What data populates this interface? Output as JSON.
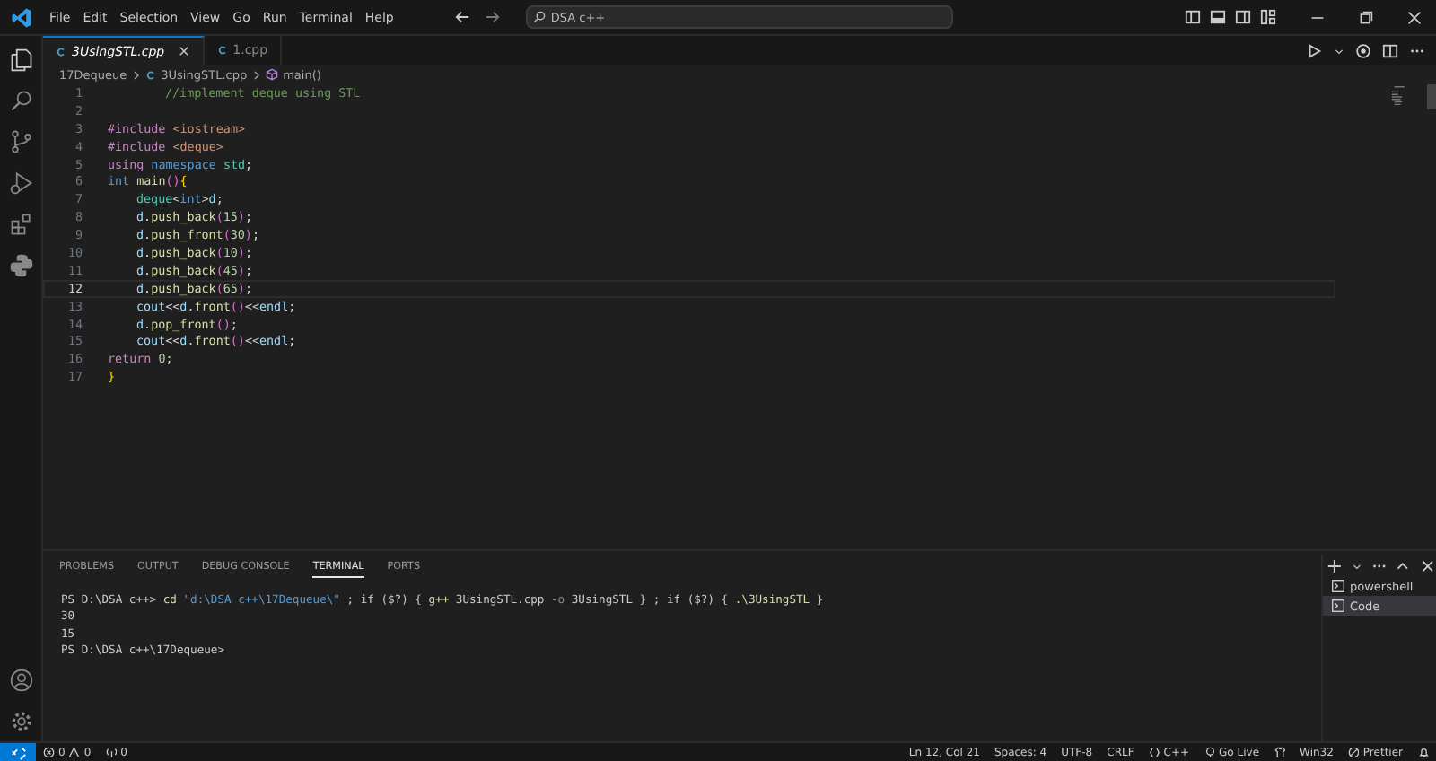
{
  "menu": [
    "File",
    "Edit",
    "Selection",
    "View",
    "Go",
    "Run",
    "Terminal",
    "Help"
  ],
  "search": {
    "value": "DSA c++"
  },
  "tabs": [
    {
      "label": "3UsingSTL.cpp",
      "selected": true
    },
    {
      "label": "1.cpp",
      "selected": false
    }
  ],
  "breadcrumbs": [
    "17Dequeue",
    "3UsingSTL.cpp",
    "main()"
  ],
  "code": {
    "lines": [
      {
        "number": "1",
        "kind": "comment",
        "current": false,
        "tokens": [
          {
            "kind": "comment",
            "text": "//implement deque using STL"
          }
        ]
      },
      {
        "number": "2",
        "current": false
      },
      {
        "number": "3",
        "current": false,
        "tokens": [
          {
            "kind": "directive",
            "text": "#include "
          },
          {
            "kind": "string",
            "text": "<iostream>"
          }
        ]
      },
      {
        "number": "4",
        "current": false,
        "tokens": [
          {
            "kind": "directive",
            "text": "#include "
          },
          {
            "kind": "string",
            "text": "<deque>"
          }
        ]
      },
      {
        "number": "5",
        "current": false,
        "tokens": [
          {
            "kind": "directive",
            "text": "using "
          },
          {
            "kind": "keyword",
            "text": "namespace "
          },
          {
            "kind": "type",
            "text": "std"
          },
          {
            "kind": "plain",
            "text": ";"
          }
        ]
      },
      {
        "number": "6",
        "current": false,
        "tokens": [
          {
            "kind": "keyword",
            "text": "int "
          },
          {
            "kind": "func",
            "text": "main"
          },
          {
            "kind": "bracket",
            "text": "()"
          },
          {
            "kind": "bracket2",
            "text": "{"
          }
        ],
        "children": [
          {
            "number": "7",
            "current": false,
            "tokens": [
              {
                "kind": "type",
                "text": "deque"
              },
              {
                "kind": "plain",
                "text": "<"
              },
              {
                "kind": "keyword",
                "text": "int"
              },
              {
                "kind": "plain",
                "text": ">"
              },
              {
                "kind": "var",
                "text": "d"
              },
              {
                "kind": "plain",
                "text": ";"
              }
            ]
          },
          {
            "number": "8",
            "current": false,
            "tokens": [
              {
                "kind": "var",
                "text": "d"
              },
              {
                "kind": "plain",
                "text": "."
              },
              {
                "kind": "func",
                "text": "push_back"
              },
              {
                "kind": "bracket",
                "text": "("
              },
              {
                "kind": "number",
                "text": "15"
              },
              {
                "kind": "bracket",
                "text": ")"
              },
              {
                "kind": "plain",
                "text": ";"
              }
            ]
          },
          {
            "number": "9",
            "current": false,
            "tokens": [
              {
                "kind": "var",
                "text": "d"
              },
              {
                "kind": "plain",
                "text": "."
              },
              {
                "kind": "func",
                "text": "push_front"
              },
              {
                "kind": "bracket",
                "text": "("
              },
              {
                "kind": "number",
                "text": "30"
              },
              {
                "kind": "bracket",
                "text": ")"
              },
              {
                "kind": "plain",
                "text": ";"
              }
            ]
          },
          {
            "number": "10",
            "current": false,
            "tokens": [
              {
                "kind": "var",
                "text": "d"
              },
              {
                "kind": "plain",
                "text": "."
              },
              {
                "kind": "func",
                "text": "push_back"
              },
              {
                "kind": "bracket",
                "text": "("
              },
              {
                "kind": "number",
                "text": "10"
              },
              {
                "kind": "bracket",
                "text": ")"
              },
              {
                "kind": "plain",
                "text": ";"
              }
            ]
          },
          {
            "number": "11",
            "current": false,
            "tokens": [
              {
                "kind": "var",
                "text": "d"
              },
              {
                "kind": "plain",
                "text": "."
              },
              {
                "kind": "func",
                "text": "push_back"
              },
              {
                "kind": "bracket",
                "text": "("
              },
              {
                "kind": "number",
                "text": "45"
              },
              {
                "kind": "bracket",
                "text": ")"
              },
              {
                "kind": "plain",
                "text": ";"
              }
            ]
          },
          {
            "number": "12",
            "current": true,
            "tokens": [
              {
                "kind": "var",
                "text": "d"
              },
              {
                "kind": "plain",
                "text": "."
              },
              {
                "kind": "func",
                "text": "push_back"
              },
              {
                "kind": "bracket",
                "text": "("
              },
              {
                "kind": "number",
                "text": "65"
              },
              {
                "kind": "bracket",
                "text": ")"
              },
              {
                "kind": "plain",
                "text": ";"
              }
            ]
          },
          {
            "number": "13",
            "current": false,
            "tokens": [
              {
                "kind": "var",
                "text": "cout"
              },
              {
                "kind": "plain",
                "text": "<<"
              },
              {
                "kind": "var",
                "text": "d"
              },
              {
                "kind": "plain",
                "text": "."
              },
              {
                "kind": "func",
                "text": "front"
              },
              {
                "kind": "bracket",
                "text": "()"
              },
              {
                "kind": "plain",
                "text": "<<"
              },
              {
                "kind": "var",
                "text": "endl"
              },
              {
                "kind": "plain",
                "text": ";"
              }
            ]
          },
          {
            "number": "14",
            "current": false,
            "tokens": [
              {
                "kind": "var",
                "text": "d"
              },
              {
                "kind": "plain",
                "text": "."
              },
              {
                "kind": "func",
                "text": "pop_front"
              },
              {
                "kind": "bracket",
                "text": "()"
              },
              {
                "kind": "plain",
                "text": ";"
              }
            ]
          },
          {
            "number": "15",
            "current": false,
            "tokens": [
              {
                "kind": "var",
                "text": "cout"
              },
              {
                "kind": "plain",
                "text": "<<"
              },
              {
                "kind": "var",
                "text": "d"
              },
              {
                "kind": "plain",
                "text": "."
              },
              {
                "kind": "func",
                "text": "front"
              },
              {
                "kind": "bracket",
                "text": "()"
              },
              {
                "kind": "plain",
                "text": "<<"
              },
              {
                "kind": "var",
                "text": "endl"
              },
              {
                "kind": "plain",
                "text": ";"
              }
            ]
          }
        ]
      },
      {
        "number": "16",
        "current": false,
        "tokens": [
          {
            "kind": "directive",
            "text": "return "
          },
          {
            "kind": "number",
            "text": "0"
          },
          {
            "kind": "plain",
            "text": ";"
          }
        ]
      },
      {
        "number": "17",
        "current": false,
        "tokens": [
          {
            "kind": "bracket2",
            "text": "}"
          }
        ]
      }
    ]
  },
  "panel_tabs": [
    {
      "label": "PROBLEMS",
      "selected": false
    },
    {
      "label": "OUTPUT",
      "selected": false
    },
    {
      "label": "DEBUG CONSOLE",
      "selected": false
    },
    {
      "label": "TERMINAL",
      "selected": true
    },
    {
      "label": "PORTS",
      "selected": false
    }
  ],
  "terminal_lines": [
    {
      "tokens": [
        {
          "kind": "plain",
          "text": "PS D:\\DSA c++> "
        },
        {
          "kind": "command",
          "text": "cd "
        },
        {
          "kind": "string",
          "text": "\"d:\\DSA c++\\17Dequeue\\\""
        },
        {
          "kind": "plain",
          "text": " ; if ($?) { "
        },
        {
          "kind": "command",
          "text": "g++"
        },
        {
          "kind": "plain",
          "text": " 3UsingSTL.cpp "
        },
        {
          "kind": "option",
          "text": "-o"
        },
        {
          "kind": "plain",
          "text": " 3UsingSTL } ; if ($?) { "
        },
        {
          "kind": "command",
          "text": ".\\3UsingSTL"
        },
        {
          "kind": "plain",
          "text": " }"
        }
      ]
    },
    {
      "tokens": [
        {
          "kind": "plain",
          "text": "30"
        }
      ]
    },
    {
      "tokens": [
        {
          "kind": "plain",
          "text": "15"
        }
      ]
    },
    {
      "tokens": [
        {
          "kind": "plain",
          "text": "PS D:\\DSA c++\\17Dequeue>"
        }
      ]
    }
  ],
  "terminals": [
    {
      "label": "powershell",
      "selected": false
    },
    {
      "label": "Code",
      "selected": true
    }
  ],
  "status_bar": {
    "errors": "0",
    "warnings": "0",
    "ports": "0",
    "position": "Ln 12, Col 21",
    "spaces": "Spaces: 4",
    "encoding": "UTF-8",
    "eol": "CRLF",
    "language": "C++",
    "go_live": "Go Live",
    "platform": "Win32",
    "formatter": "Prettier"
  }
}
